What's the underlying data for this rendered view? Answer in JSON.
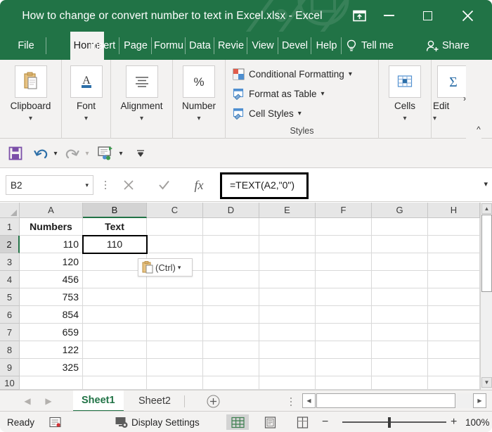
{
  "window": {
    "title": "How to change or convert number to text in Excel.xlsx  -  Excel",
    "ribbon_display_options": "ribbon-display-options",
    "minimize": "Minimize",
    "maximize": "Maximize",
    "close": "Close",
    "accent_green": "#217346"
  },
  "tabs": [
    {
      "label": "File",
      "active": false
    },
    {
      "label": "Home",
      "active": true
    },
    {
      "label": "Insert",
      "active": false
    },
    {
      "label": "Page",
      "active": false
    },
    {
      "label": "Formu",
      "active": false
    },
    {
      "label": "Data",
      "active": false
    },
    {
      "label": "Revie",
      "active": false
    },
    {
      "label": "View",
      "active": false
    },
    {
      "label": "Devel",
      "active": false
    },
    {
      "label": "Help",
      "active": false
    }
  ],
  "tellme": {
    "label": "Tell me"
  },
  "share": {
    "label": "Share"
  },
  "ribbon": {
    "groups": [
      {
        "label": "Clipboard",
        "icon": "clipboard-icon"
      },
      {
        "label": "Font",
        "icon": "font-icon"
      },
      {
        "label": "Alignment",
        "icon": "alignment-icon"
      },
      {
        "label": "Number",
        "icon": "percent-icon"
      }
    ],
    "styles": {
      "name": "Styles",
      "items": [
        {
          "label": "Conditional Formatting",
          "icon": "conditional-formatting-icon"
        },
        {
          "label": "Format as Table",
          "icon": "format-as-table-icon"
        },
        {
          "label": "Cell Styles",
          "icon": "cell-styles-icon"
        }
      ]
    },
    "cells": {
      "label": "Cells",
      "icon": "cells-icon"
    },
    "editing": {
      "label": "Edit",
      "icon": "editing-icon"
    },
    "collapse": "^"
  },
  "qat": {
    "save": "Save",
    "undo": "Undo",
    "redo": "Redo",
    "send": "Send to",
    "customize": "Customize Quick Access Toolbar"
  },
  "formula_bar": {
    "name_box": "B2",
    "cancel": "cancel-icon",
    "enter": "enter-icon",
    "insert_function": "fx",
    "value": "=TEXT(A2,\"0\")",
    "expand": "expand-formula-bar",
    "highlight_color": "#000000"
  },
  "grid": {
    "columns": [
      "A",
      "B",
      "C",
      "D",
      "E",
      "F",
      "G",
      "H"
    ],
    "selected_column": "B",
    "rows": [
      "1",
      "2",
      "3",
      "4",
      "5",
      "6",
      "7",
      "8",
      "9",
      "10"
    ],
    "selected_row": "2",
    "data": [
      {
        "row": "1",
        "A": "Numbers",
        "B": "Text"
      },
      {
        "row": "2",
        "A": "110",
        "B": "110"
      },
      {
        "row": "3",
        "A": "120",
        "B": ""
      },
      {
        "row": "4",
        "A": "456",
        "B": ""
      },
      {
        "row": "5",
        "A": "753",
        "B": ""
      },
      {
        "row": "6",
        "A": "854",
        "B": ""
      },
      {
        "row": "7",
        "A": "659",
        "B": ""
      },
      {
        "row": "8",
        "A": "122",
        "B": ""
      },
      {
        "row": "9",
        "A": "325",
        "B": ""
      },
      {
        "row": "10",
        "A": "",
        "B": ""
      }
    ],
    "active_cell": "B2",
    "paste_options": {
      "label": "(Ctrl)",
      "icon": "paste-options-icon"
    }
  },
  "sheet_bar": {
    "prev": "◀",
    "next": "▶",
    "sheets": [
      {
        "label": "Sheet1",
        "active": true
      },
      {
        "label": "Sheet2",
        "active": false
      }
    ],
    "add_sheet": "+"
  },
  "status_bar": {
    "state": "Ready",
    "macro_icon": "record-macro-icon",
    "display_settings": "Display Settings",
    "views": [
      {
        "name": "normal-view",
        "active": true
      },
      {
        "name": "page-layout-view",
        "active": false
      },
      {
        "name": "page-break-view",
        "active": false
      }
    ],
    "zoom_out": "−",
    "zoom_in": "+",
    "zoom_level": "100%"
  }
}
